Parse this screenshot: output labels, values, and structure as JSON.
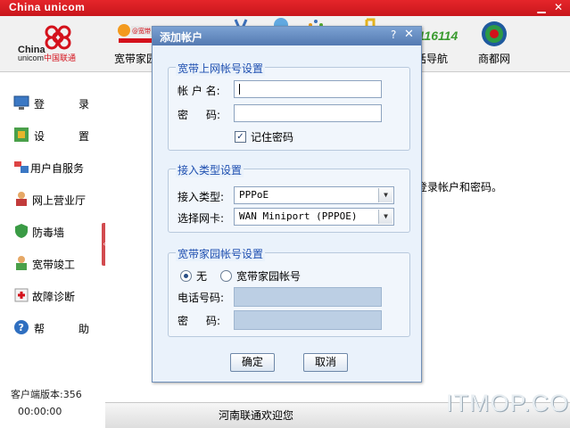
{
  "window": {
    "title": "China unicom"
  },
  "brand": {
    "line1": "China",
    "line2": "unicom",
    "line2_cn": "中国联通"
  },
  "nav": {
    "items": [
      {
        "label": "宽带家园",
        "icon": "wo-broadband-icon"
      },
      {
        "label": "话导航",
        "icon": "phone-navigation-icon"
      },
      {
        "label": "商都网",
        "icon": "shangdu-globe-icon"
      }
    ],
    "logo_116114": "116114"
  },
  "sidebar": {
    "items": [
      {
        "label_a": "登",
        "label_b": "录",
        "icon": "monitor-icon"
      },
      {
        "label_a": "设",
        "label_b": "置",
        "icon": "settings-icon"
      },
      {
        "label": "用户自服务",
        "icon": "self-service-icon"
      },
      {
        "label": "网上营业厅",
        "icon": "online-hall-icon"
      },
      {
        "label": "防毒墙",
        "icon": "shield-icon"
      },
      {
        "label": "宽带竣工",
        "icon": "install-icon"
      },
      {
        "label": "故障诊断",
        "icon": "diagnose-icon"
      },
      {
        "label_a": "帮",
        "label_b": "助",
        "icon": "help-icon"
      }
    ],
    "version": "客户端版本:356",
    "timer": "00:00:00"
  },
  "main": {
    "hint": "登录帐户和密码。"
  },
  "status": {
    "message": "河南联通欢迎您"
  },
  "watermark": "ITMOP.COM",
  "dialog": {
    "title": "添加帐户",
    "help": "?",
    "close": "✕",
    "account_group": {
      "title": "宽带上网帐号设置",
      "username_label": "帐 户 名:",
      "username_value": "",
      "password_label_a": "密",
      "password_label_b": "码:",
      "password_value": "",
      "remember_label": "记住密码",
      "remember_checked": true
    },
    "type_group": {
      "title": "接入类型设置",
      "type_label": "接入类型:",
      "type_value": "PPPoE",
      "nic_label": "选择网卡:",
      "nic_value": "WAN Miniport (PPPOE)"
    },
    "home_group": {
      "title": "宽带家园帐号设置",
      "radio_none": "无",
      "radio_account": "宽带家园帐号",
      "selected": "none",
      "phone_label": "电话号码:",
      "password_label_a": "密",
      "password_label_b": "码:"
    },
    "ok_label": "确定",
    "cancel_label": "取消"
  }
}
